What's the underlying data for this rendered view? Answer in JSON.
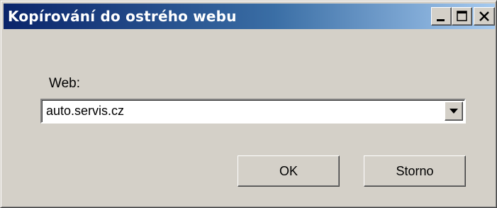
{
  "window": {
    "title": "Kopírování do ostrého webu",
    "accent_color": "#0a246a",
    "controls": [
      "minimize-icon",
      "maximize-icon",
      "close-icon"
    ]
  },
  "form": {
    "web_label": "Web:",
    "web_value": "auto.servis.cz"
  },
  "buttons": {
    "ok_label": "OK",
    "cancel_label": "Storno"
  }
}
